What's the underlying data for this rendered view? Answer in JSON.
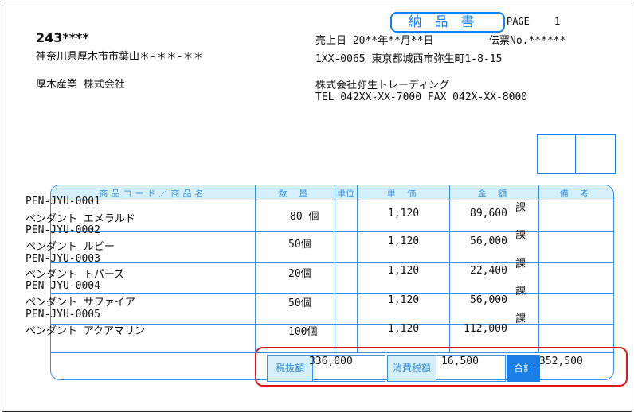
{
  "header": {
    "title": "納品書",
    "page_label": "PAGE",
    "page_number": "1",
    "customer_code": "243****",
    "customer_address": "神奈川県厚木市市葉山＊-＊＊-＊＊",
    "customer_name": "厚木産業 株式会社",
    "sales_date": "売上日 20**年**月**日",
    "slip_no": "伝票No.******",
    "company_address": "1XX-0065 東京都城西市弥生町1-8-15",
    "company_name": "株式会社弥生トレーディング",
    "company_tel_fax": "TEL  042XX-XX-7000  FAX  042X-XX-8000"
  },
  "table": {
    "columns": [
      "商品コード／商品名",
      "数 量",
      "単位",
      "単 価",
      "金 額",
      "備 考"
    ],
    "rows": [
      {
        "code": "PEN-JYU-0001",
        "name": "ペンダント エメラルド",
        "qty": "80 個",
        "price": "1,120",
        "amount": "89,600",
        "tax": "課"
      },
      {
        "code": "PEN-JYU-0002",
        "name": "ペンダント ルビー",
        "qty": "50個",
        "price": "1,120",
        "amount": "56,000",
        "tax": "課"
      },
      {
        "code": "PEN-JYU-0003",
        "name": "ペンダント トパーズ",
        "qty": "20個",
        "price": "1,120",
        "amount": "22,400",
        "tax": "課"
      },
      {
        "code": "PEN-JYU-0004",
        "name": "ペンダント サファイア",
        "qty": "50個",
        "price": "1,120",
        "amount": "56,000",
        "tax": "課"
      },
      {
        "code": "PEN-JYU-0005",
        "name": "ペンダント アクアマリン",
        "qty": "100個",
        "price": "1,120",
        "amount": "112,000",
        "tax": "課"
      }
    ]
  },
  "totals": {
    "subtotal_label": "税抜額",
    "subtotal": "336,000",
    "tax_label": "消費税額",
    "tax": "16,500",
    "total_label": "合計",
    "total": "352,500"
  },
  "colors": {
    "accent": "#1a7fe8",
    "header_fill": "#d6f0fb",
    "highlight": "#e01818"
  }
}
